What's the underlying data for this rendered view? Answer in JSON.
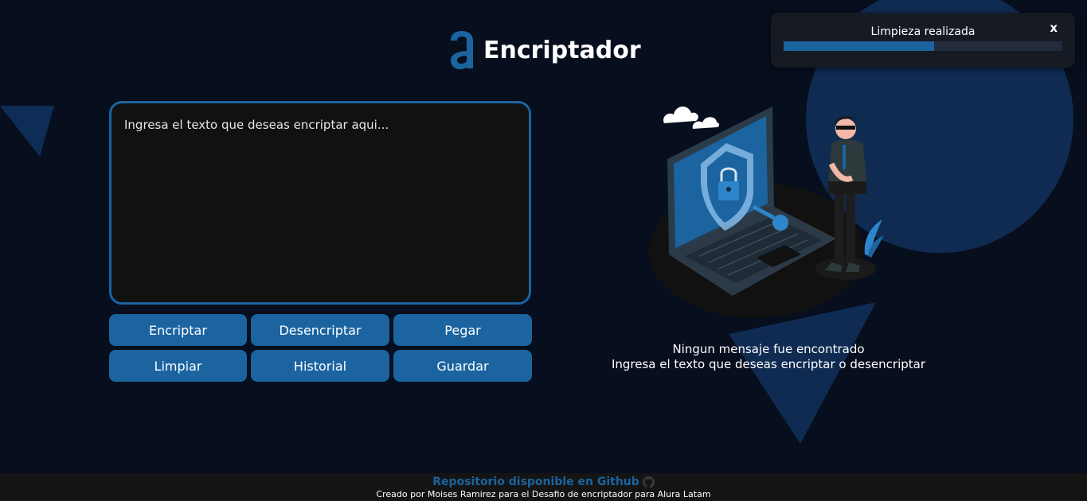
{
  "header": {
    "app_title": "Encriptador",
    "logo_letter": "a"
  },
  "input": {
    "placeholder": "Ingresa el texto que deseas encriptar aqui...",
    "value": ""
  },
  "buttons": {
    "encrypt": "Encriptar",
    "decrypt": "Desencriptar",
    "paste": "Pegar",
    "clear": "Limpiar",
    "history": "Historial",
    "save": "Guardar"
  },
  "output": {
    "title": "Ningun mensaje fue encontrado",
    "subtitle": "Ingresa el texto que deseas encriptar o desencriptar"
  },
  "toast": {
    "message": "Limpieza realizada",
    "close_label": "x",
    "progress": 0.54
  },
  "footer": {
    "repo_link": "Repositorio disponible en Github",
    "credit": "Creado por Moises Ramirez para el Desafio de encriptador para Alura Latam"
  },
  "icons": {
    "logo": "alura-a-logo",
    "github": "github-icon",
    "illustration": "security-laptop-illustration"
  },
  "colors": {
    "background": "#070e1d",
    "accent": "#1b64a0",
    "panel": "#111111",
    "footer": "#141414",
    "toast": "#161b23"
  }
}
